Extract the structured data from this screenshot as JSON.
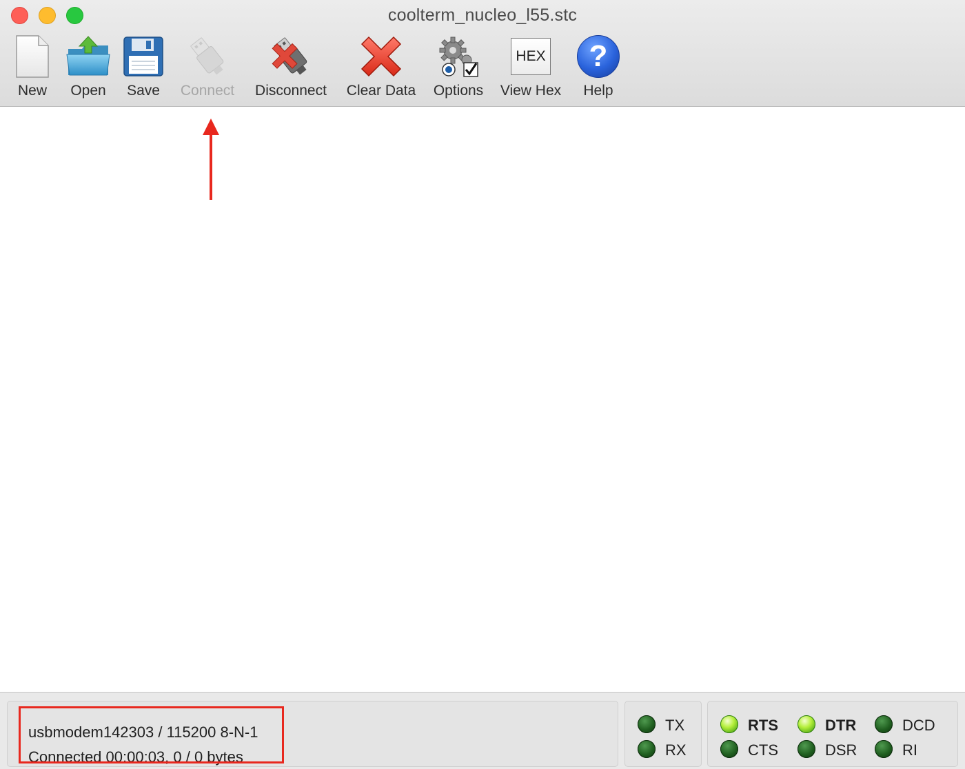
{
  "window": {
    "title": "coolterm_nucleo_l55.stc"
  },
  "toolbar": {
    "items": [
      {
        "label": "New",
        "icon": "new-document-icon",
        "enabled": true
      },
      {
        "label": "Open",
        "icon": "open-folder-icon",
        "enabled": true
      },
      {
        "label": "Save",
        "icon": "floppy-disk-icon",
        "enabled": true
      },
      {
        "label": "Connect",
        "icon": "usb-plug-icon",
        "enabled": false
      },
      {
        "label": "Disconnect",
        "icon": "usb-plug-disconnect-icon",
        "enabled": true
      },
      {
        "label": "Clear Data",
        "icon": "red-x-icon",
        "enabled": true
      },
      {
        "label": "Options",
        "icon": "gears-options-icon",
        "enabled": true
      },
      {
        "label": "View Hex",
        "icon": "hex-icon",
        "enabled": true,
        "icon_text": "HEX"
      },
      {
        "label": "Help",
        "icon": "help-question-icon",
        "enabled": true,
        "icon_text": "?"
      }
    ]
  },
  "status": {
    "port_settings": "usbmodem142303 / 115200 8-N-1",
    "connection": "Connected 00:00:03, 0 / 0 bytes"
  },
  "indicators": {
    "tx": {
      "label": "TX",
      "on": false
    },
    "rx": {
      "label": "RX",
      "on": false
    },
    "rts": {
      "label": "RTS",
      "on": true
    },
    "cts": {
      "label": "CTS",
      "on": false
    },
    "dtr": {
      "label": "DTR",
      "on": true
    },
    "dsr": {
      "label": "DSR",
      "on": false
    },
    "dcd": {
      "label": "DCD",
      "on": false
    },
    "ri": {
      "label": "RI",
      "on": false
    }
  },
  "colors": {
    "annotation": "#e8281e",
    "led_on": "#b5ef3c",
    "led_off": "#1f5e1f"
  }
}
